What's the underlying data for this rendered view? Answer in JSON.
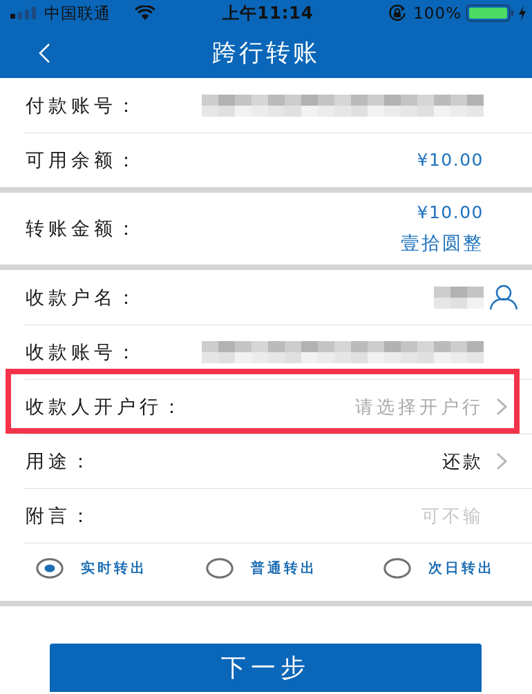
{
  "status_bar": {
    "carrier": "中国联通",
    "time": "上午11:14",
    "battery": "100%"
  },
  "nav": {
    "title": "跨行转账"
  },
  "sections": [
    {
      "rows": [
        {
          "label": "付款账号：",
          "kind": "masked",
          "highlighted": false
        },
        {
          "label": "可用余额：",
          "kind": "amount",
          "value": "¥10.00",
          "highlighted": false
        }
      ]
    },
    {
      "rows": [
        {
          "label": "转账金额：",
          "kind": "amount",
          "value": "¥10.00",
          "in_words": "壹拾圆整",
          "highlighted": false
        }
      ]
    },
    {
      "rows": [
        {
          "label": "收款户名：",
          "kind": "masked",
          "contact_picker": true,
          "highlighted": false
        },
        {
          "label": "收款账号：",
          "kind": "masked",
          "highlighted": false
        },
        {
          "label": "收款人开户行：",
          "kind": "select",
          "placeholder": "请选择开户行",
          "highlighted": true
        },
        {
          "label": "用途：",
          "kind": "select",
          "value": "还款",
          "highlighted": false
        },
        {
          "label": "附言：",
          "kind": "input",
          "placeholder": "可不输",
          "highlighted": false
        }
      ]
    }
  ],
  "transfer_modes": [
    {
      "label": "实时转出",
      "selected": true
    },
    {
      "label": "普通转出",
      "selected": false
    },
    {
      "label": "次日转出",
      "selected": false
    }
  ],
  "next_button": {
    "label": "下一步"
  }
}
